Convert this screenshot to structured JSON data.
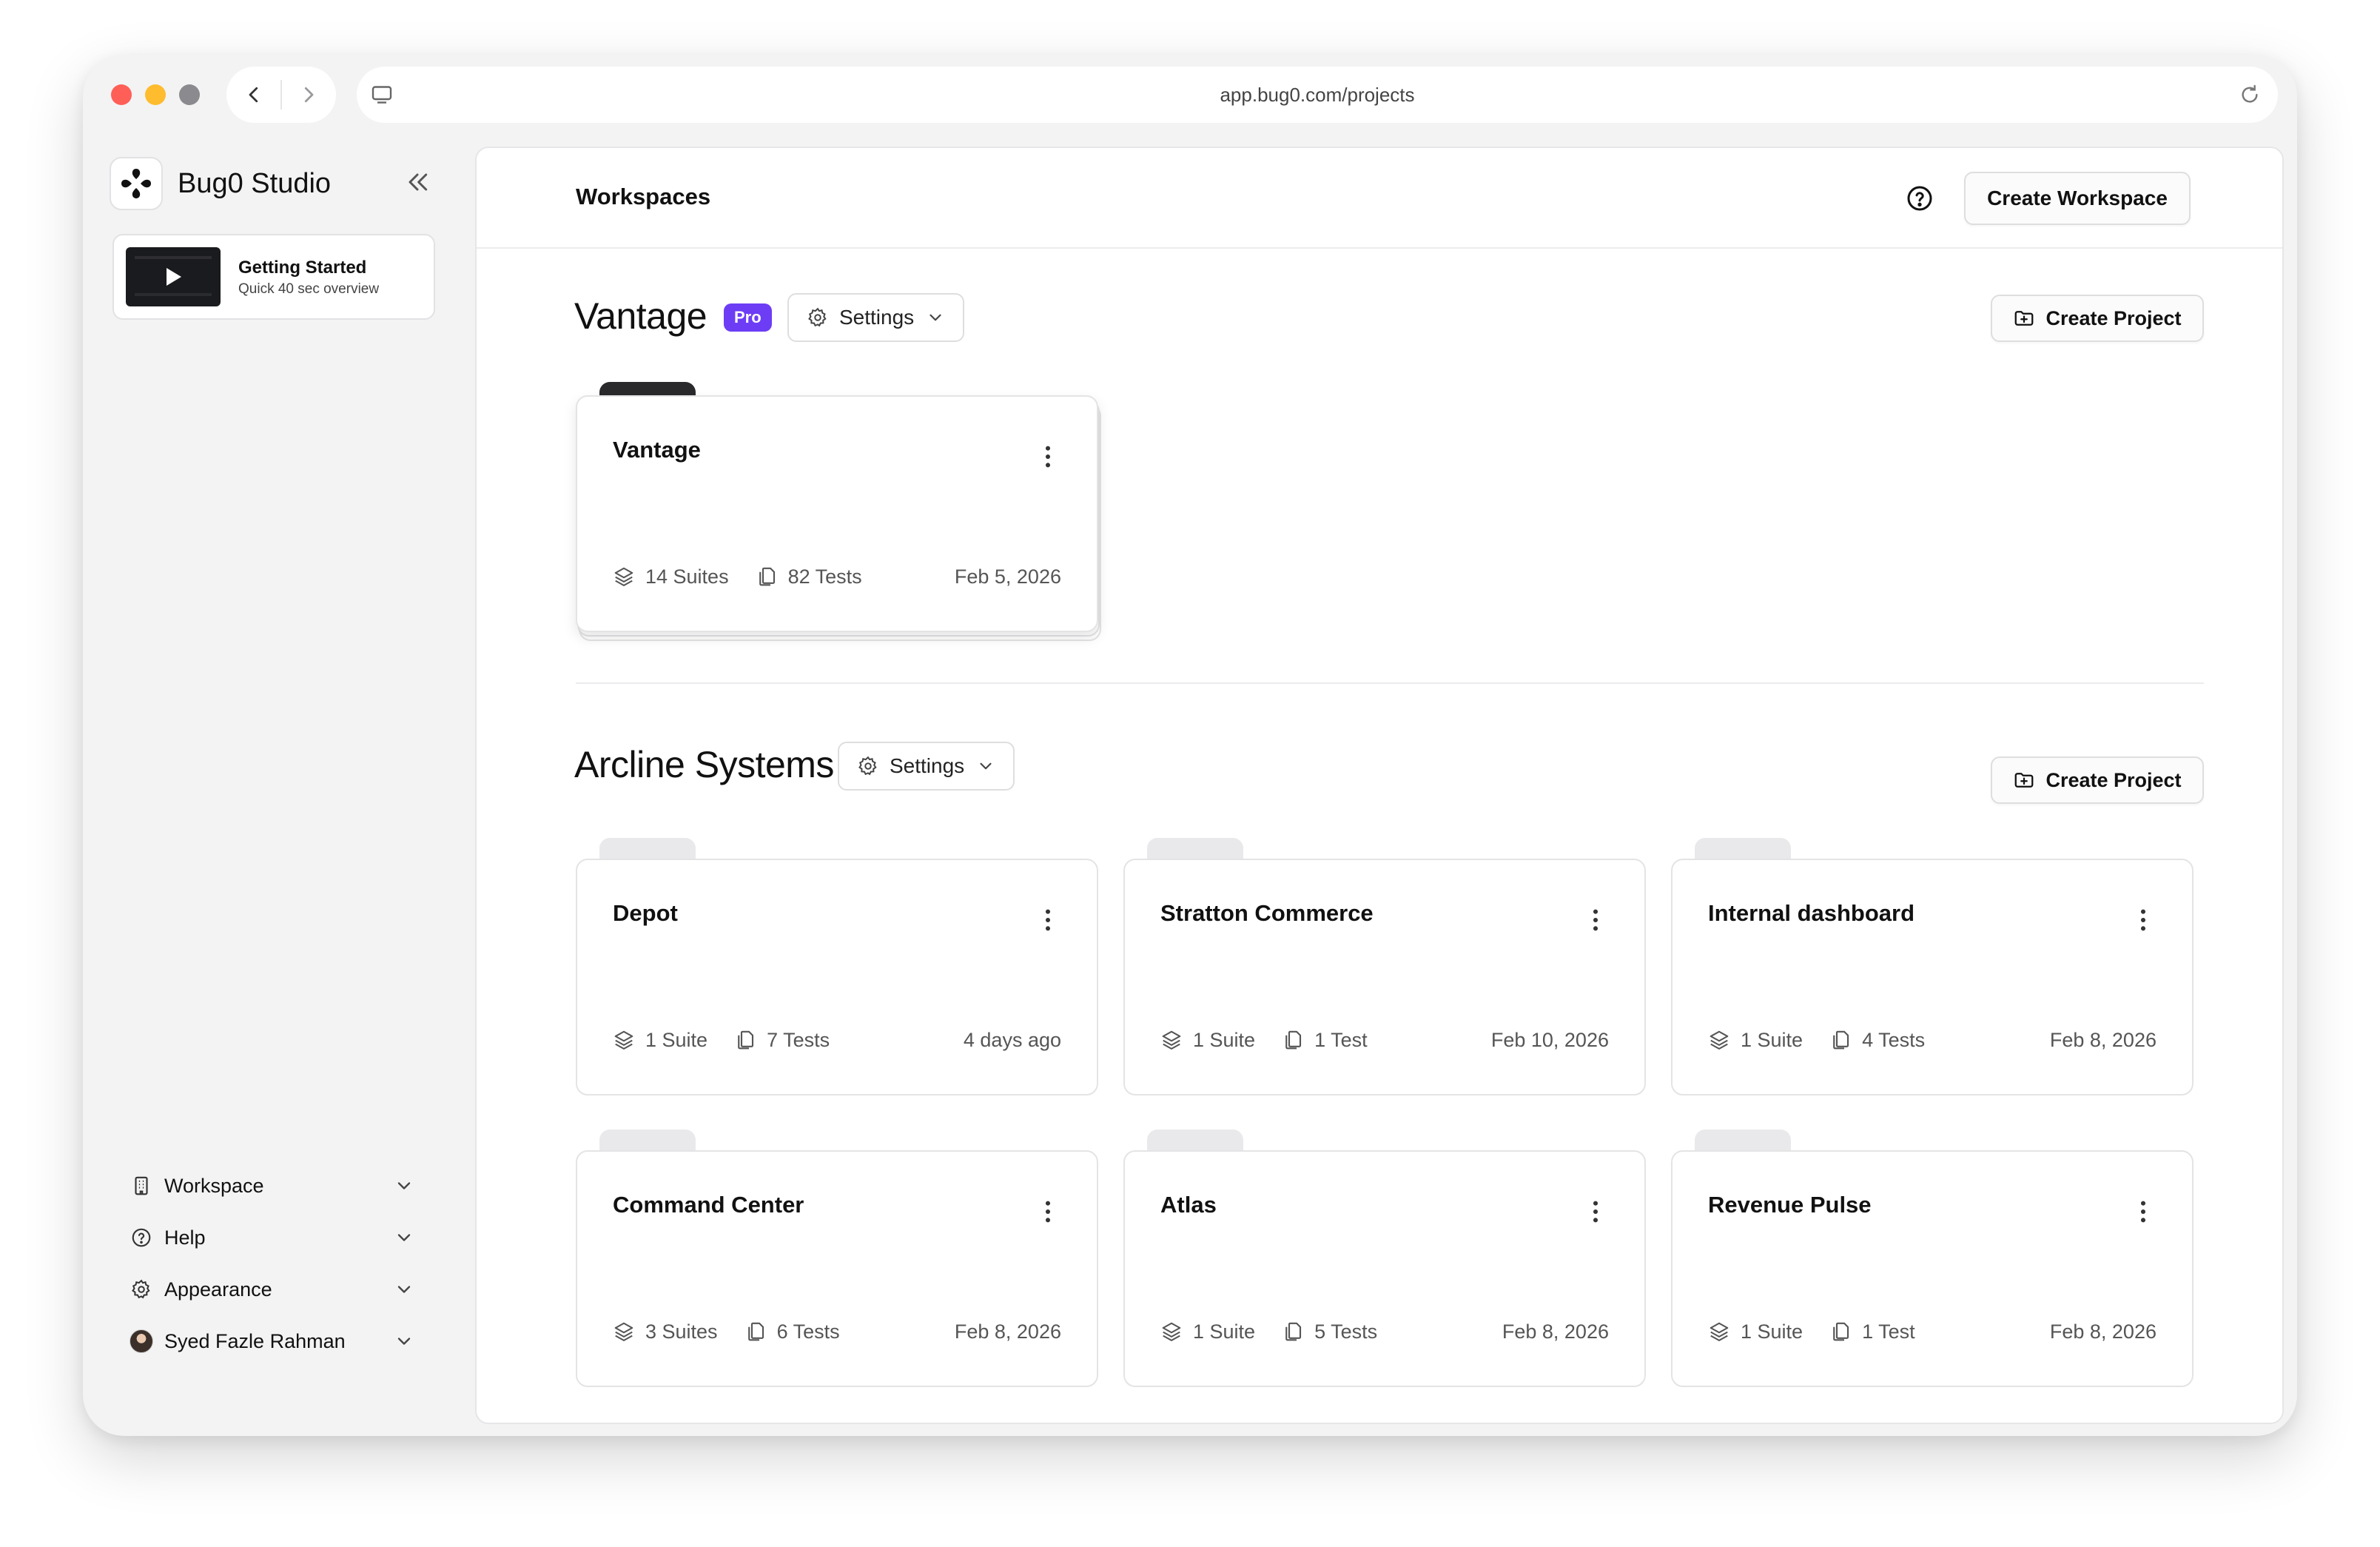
{
  "browser": {
    "url": "app.bug0.com/projects"
  },
  "sidebar": {
    "brand": "Bug0 Studio",
    "getting_started": {
      "title": "Getting Started",
      "subtitle": "Quick 40 sec overview"
    },
    "menu": [
      {
        "label": "Workspace",
        "icon": "building-icon"
      },
      {
        "label": "Help",
        "icon": "help-circle-icon"
      },
      {
        "label": "Appearance",
        "icon": "gear-icon"
      },
      {
        "label": "Syed Fazle Rahman",
        "icon": "avatar"
      }
    ]
  },
  "header": {
    "title": "Workspaces",
    "create_workspace_label": "Create Workspace"
  },
  "workspaces": [
    {
      "name": "Vantage",
      "badge": "Pro",
      "settings_label": "Settings",
      "create_project_label": "Create Project",
      "projects": [
        {
          "name": "Vantage",
          "suites": "14 Suites",
          "tests": "82 Tests",
          "date": "Feb 5, 2026"
        }
      ]
    },
    {
      "name": "Arcline Systems",
      "settings_label": "Settings",
      "create_project_label": "Create Project",
      "projects": [
        {
          "name": "Depot",
          "suites": "1 Suite",
          "tests": "7 Tests",
          "date": "4 days ago"
        },
        {
          "name": "Stratton Commerce",
          "suites": "1 Suite",
          "tests": "1 Test",
          "date": "Feb 10, 2026"
        },
        {
          "name": "Internal dashboard",
          "suites": "1 Suite",
          "tests": "4 Tests",
          "date": "Feb 8, 2026"
        },
        {
          "name": "Command Center",
          "suites": "3 Suites",
          "tests": "6 Tests",
          "date": "Feb 8, 2026"
        },
        {
          "name": "Atlas",
          "suites": "1 Suite",
          "tests": "5 Tests",
          "date": "Feb 8, 2026"
        },
        {
          "name": "Revenue Pulse",
          "suites": "1 Suite",
          "tests": "1 Test",
          "date": "Feb 8, 2026"
        }
      ]
    }
  ],
  "colors": {
    "pro_badge": "#6d3df5",
    "traffic_red": "#ff5f57",
    "traffic_yellow": "#febc2e"
  }
}
